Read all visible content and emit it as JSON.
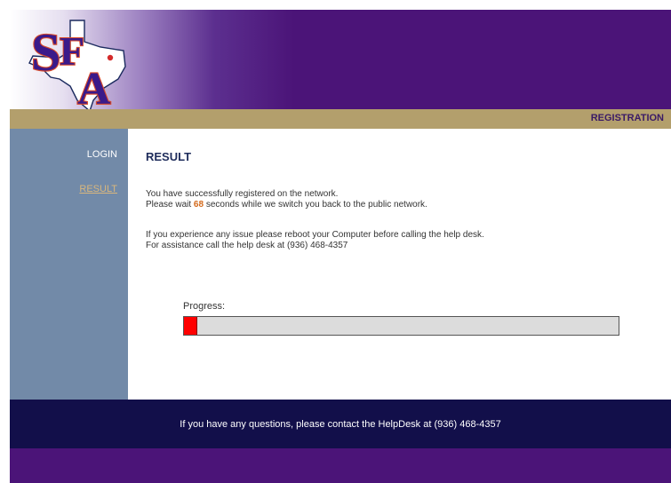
{
  "header": {
    "logo_name": "sfa-logo",
    "section_title": "REGISTRATION"
  },
  "sidebar": {
    "items": [
      {
        "label": "LOGIN"
      },
      {
        "label": "RESULT"
      }
    ]
  },
  "main": {
    "title": "RESULT",
    "line1": "You have successfully registered on the network.",
    "line2_prefix": "Please wait ",
    "seconds": "68",
    "line2_suffix": " seconds while we switch you back to the public network.",
    "line3": "If you experience any issue please reboot your Computer before calling the help desk.",
    "line4": "For assistance call the help desk at (936) 468-4357",
    "progress_label": "Progress:",
    "progress_fraction": 0.03,
    "progress_color": "#ff0000"
  },
  "footer": {
    "text": "If you have any questions, please contact the HelpDesk at (936) 468-4357"
  },
  "colors": {
    "purple": "#4b1478",
    "gold": "#b39f6c",
    "slate": "#728aa8",
    "navy": "#120f4a"
  }
}
